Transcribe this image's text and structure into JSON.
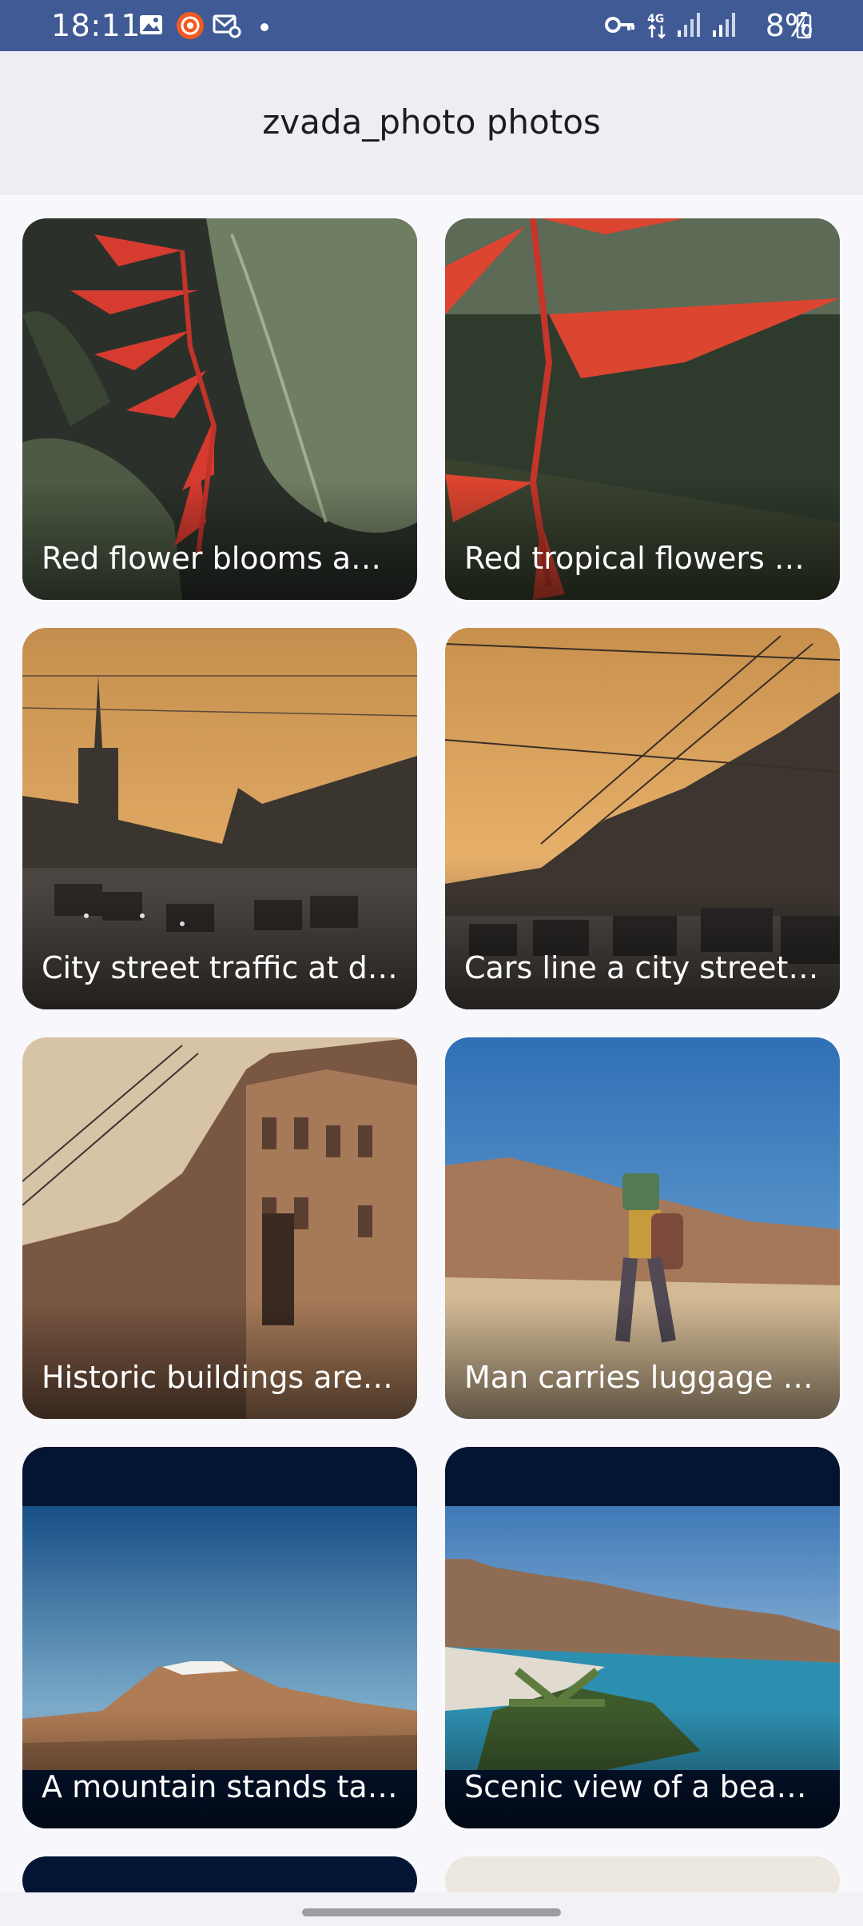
{
  "status_bar": {
    "time": "18:11",
    "battery": "8%",
    "icons": [
      "gallery-icon",
      "screen-recorder-icon",
      "mail-settings-icon",
      "dot-icon",
      "vpn-key-icon",
      "4g-data-icon",
      "signal-icon",
      "signal-icon-2",
      "battery-charging-icon"
    ]
  },
  "app_bar": {
    "title": "zvada_photo photos"
  },
  "photos": [
    {
      "caption": "Red flower blooms ami..."
    },
    {
      "caption": "Red tropical flowers ha..."
    },
    {
      "caption": "City street traffic at du..."
    },
    {
      "caption": "Cars line a city street a..."
    },
    {
      "caption": "Historic buildings are b..."
    },
    {
      "caption": "Man carries luggage on..."
    },
    {
      "caption": "A mountain stands tall ..."
    },
    {
      "caption": "Scenic view of a beach, ..."
    }
  ]
}
